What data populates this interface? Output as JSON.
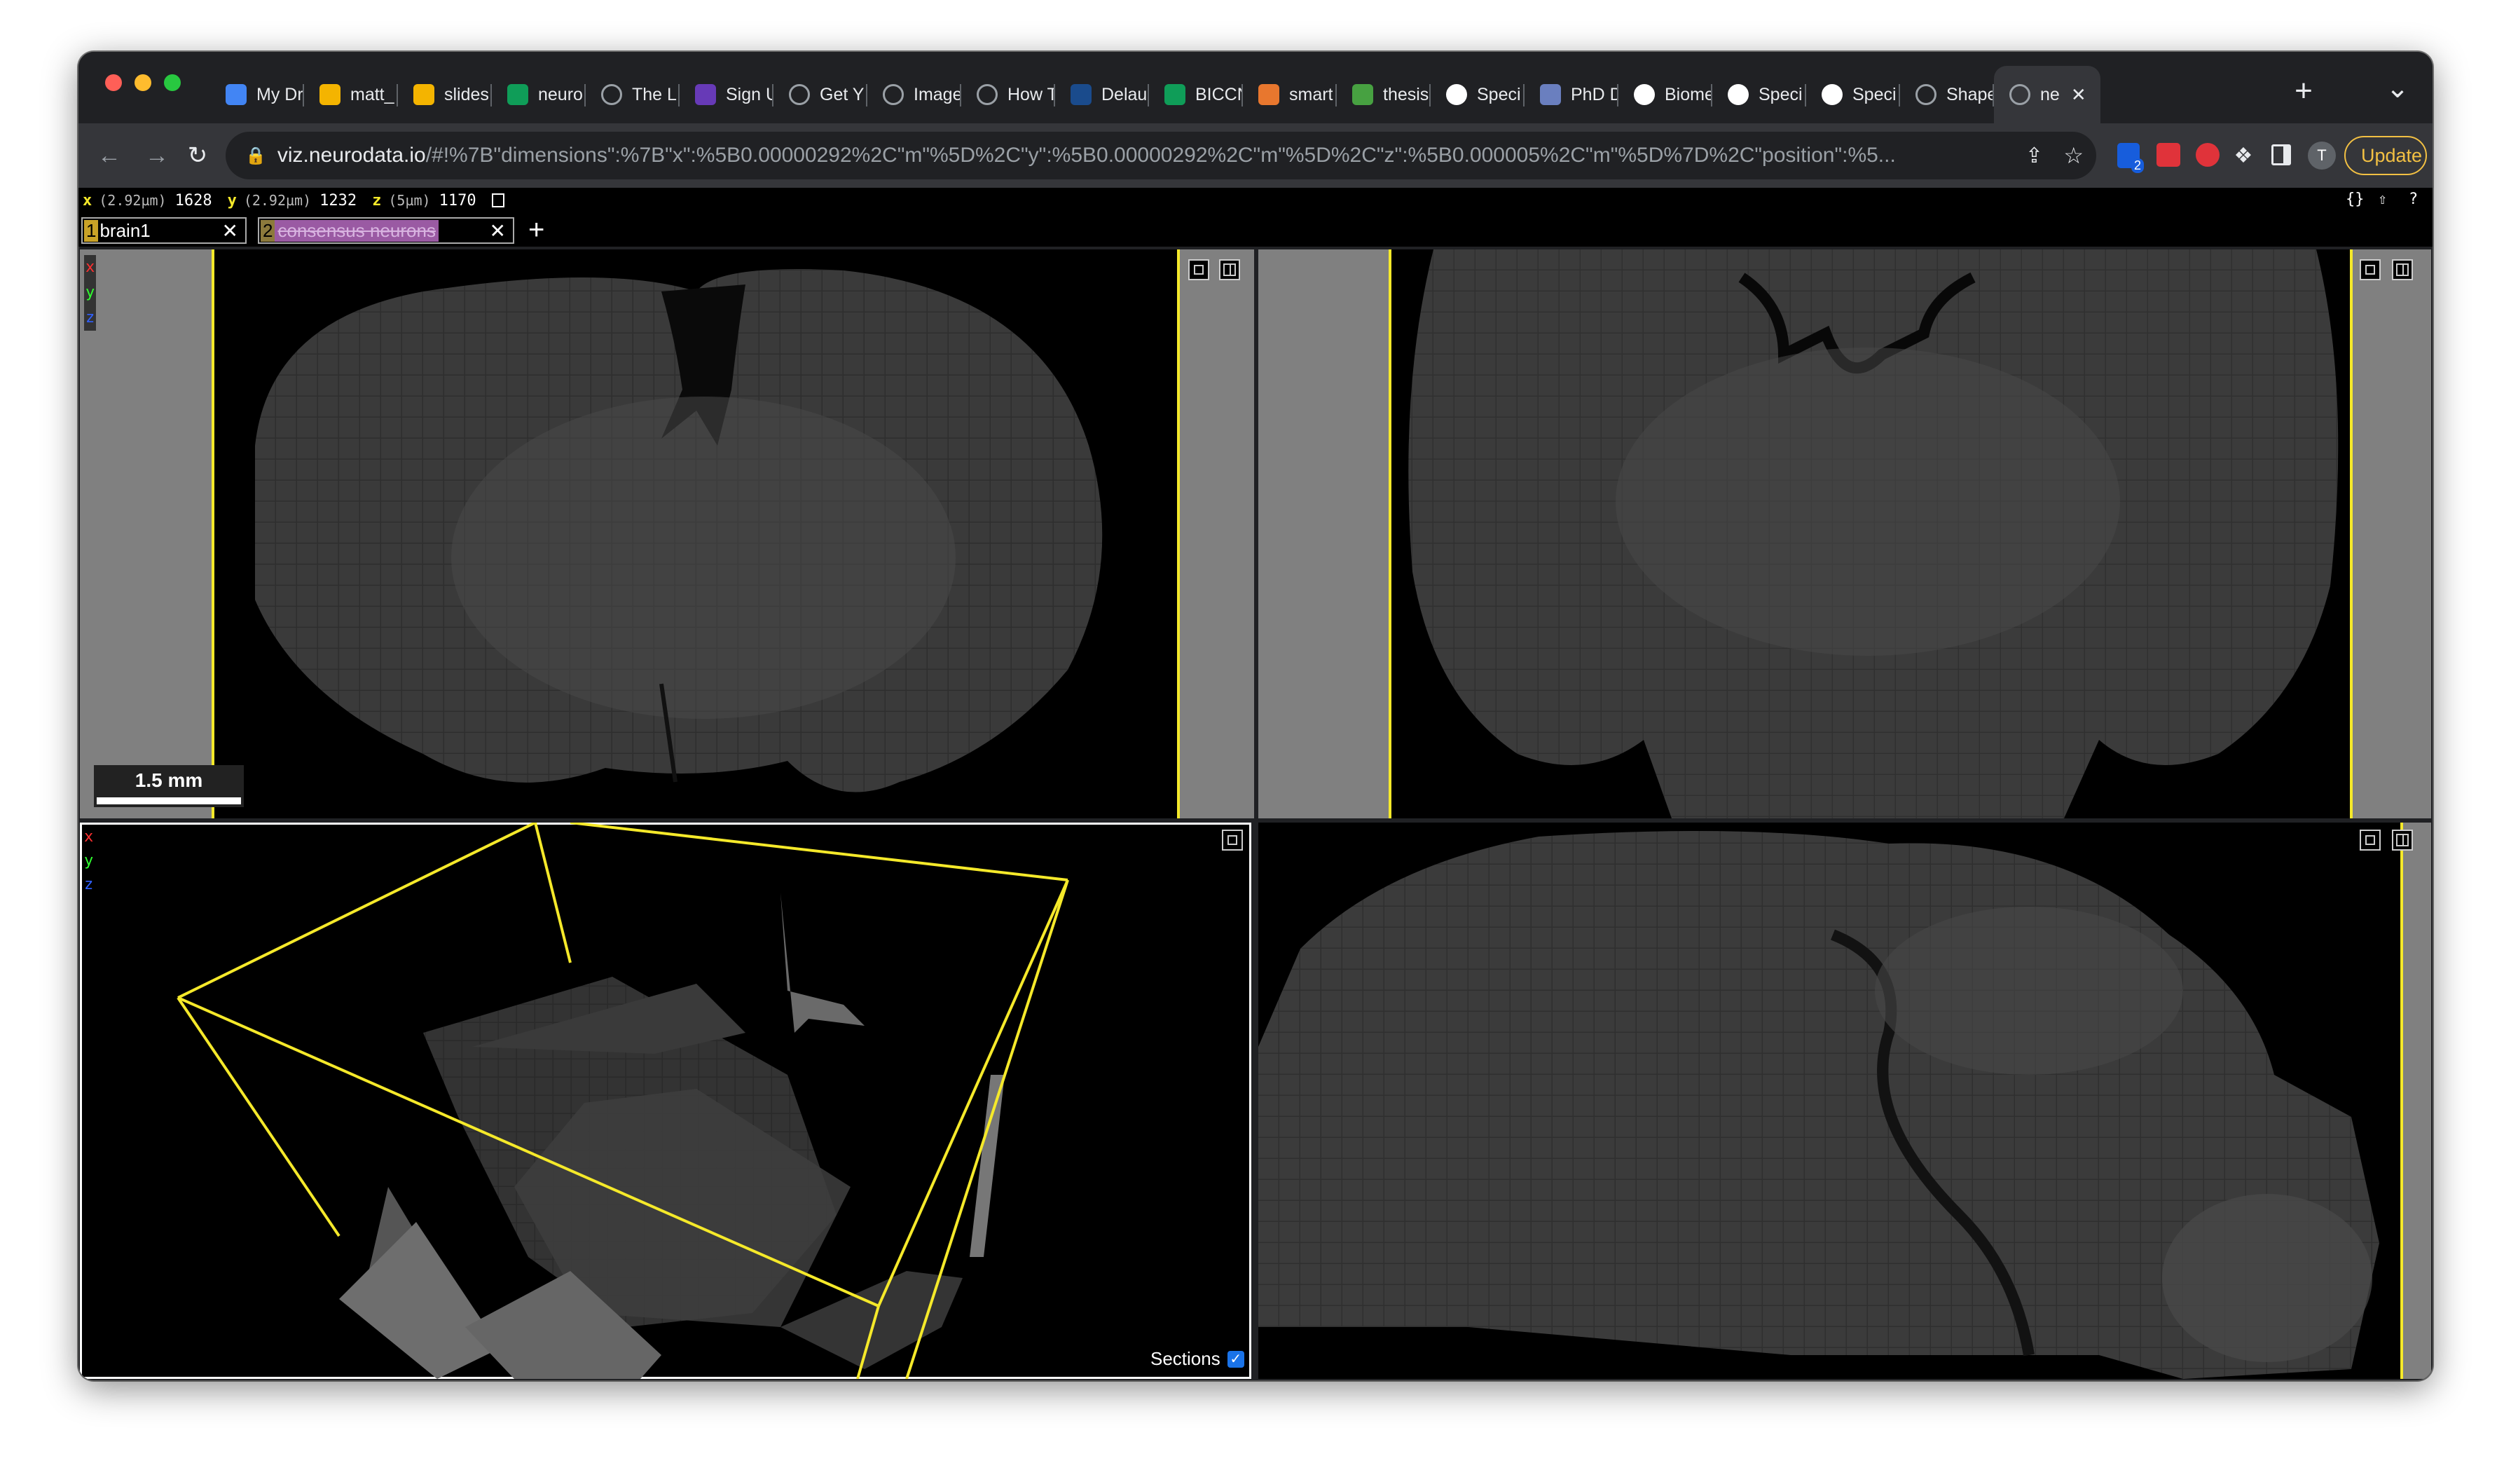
{
  "browser": {
    "tabs": [
      {
        "label": "My Dr",
        "icon": "google-drive-icon",
        "color": "#4285f4"
      },
      {
        "label": "matt_",
        "icon": "google-slides-icon",
        "color": "#f4b400"
      },
      {
        "label": "slides",
        "icon": "google-slides-icon",
        "color": "#f4b400"
      },
      {
        "label": "neuro",
        "icon": "google-sheets-icon",
        "color": "#0f9d58"
      },
      {
        "label": "The L",
        "icon": "globe-icon",
        "color": "#5f6368"
      },
      {
        "label": "Sign U",
        "icon": "form-icon",
        "color": "#673ab7"
      },
      {
        "label": "Get Y",
        "icon": "globe-icon",
        "color": "#5f6368"
      },
      {
        "label": "Image",
        "icon": "globe-icon",
        "color": "#5f6368"
      },
      {
        "label": "How T",
        "icon": "globe-icon",
        "color": "#5f6368"
      },
      {
        "label": "Delau",
        "icon": "jhu-icon",
        "color": "#1a4b8c"
      },
      {
        "label": "BICCN",
        "icon": "google-sheets-icon",
        "color": "#0f9d58"
      },
      {
        "label": "smart",
        "icon": "box-icon",
        "color": "#e8772e"
      },
      {
        "label": "thesis",
        "icon": "overleaf-icon",
        "color": "#47a141"
      },
      {
        "label": "Speci",
        "icon": "github-icon",
        "color": "#ffffff"
      },
      {
        "label": "PhD D",
        "icon": "shield-icon",
        "color": "#6a7fbf"
      },
      {
        "label": "Biome",
        "icon": "wordpress-icon",
        "color": "#ffffff"
      },
      {
        "label": "Speci",
        "icon": "github-icon",
        "color": "#ffffff"
      },
      {
        "label": "Speci",
        "icon": "github-icon",
        "color": "#ffffff"
      },
      {
        "label": "Shape",
        "icon": "globe-icon",
        "color": "#5f6368"
      },
      {
        "label": "ne",
        "icon": "globe-icon",
        "color": "#5f6368"
      }
    ],
    "new_tab": "+",
    "tab_menu": "⌄",
    "url": "viz.neurodata.io/#!%7B\"dimensions\":%7B\"x\":%5B0.00000292%2C\"m\"%5D%2C\"y\":%5B0.00000292%2C\"m\"%5D%2C\"z\":%5B0.000005%2C\"m\"%5D%7D%2C\"position\":%5...",
    "url_host": "viz.neurodata.io",
    "url_rest": "/#!%7B\"dimensions\":%7B\"x\":%5B0.00000292%2C\"m\"%5D%2C\"y\":%5B0.00000292%2C\"m\"%5D%2C\"z\":%5B0.000005%2C\"m\"%5D%7D%2C\"position\":%5...",
    "update_label": "Update",
    "profile_initial": "T",
    "ext_badge": "2"
  },
  "viewer": {
    "coords": {
      "x_label": "x",
      "x_unit": "(2.92µm)",
      "x_value": "1628",
      "y_label": "y",
      "y_unit": "(2.92µm)",
      "y_value": "1232",
      "z_label": "z",
      "z_unit": "(5µm)",
      "z_value": "1170"
    },
    "right_icons": [
      "{}",
      "⇧",
      "?"
    ],
    "layers": [
      {
        "num": "1",
        "name": "brain1"
      },
      {
        "num": "2",
        "name": "consensus neurons"
      }
    ],
    "add_layer": "+",
    "axis_labels": [
      "x",
      "y",
      "z"
    ],
    "scale_bar": "1.5 mm",
    "sections_label": "Sections",
    "sections_checked": true,
    "colors": {
      "x": "#ff3030",
      "y": "#30ff30",
      "z": "#3060ff",
      "outline": "#f5e92a"
    }
  }
}
